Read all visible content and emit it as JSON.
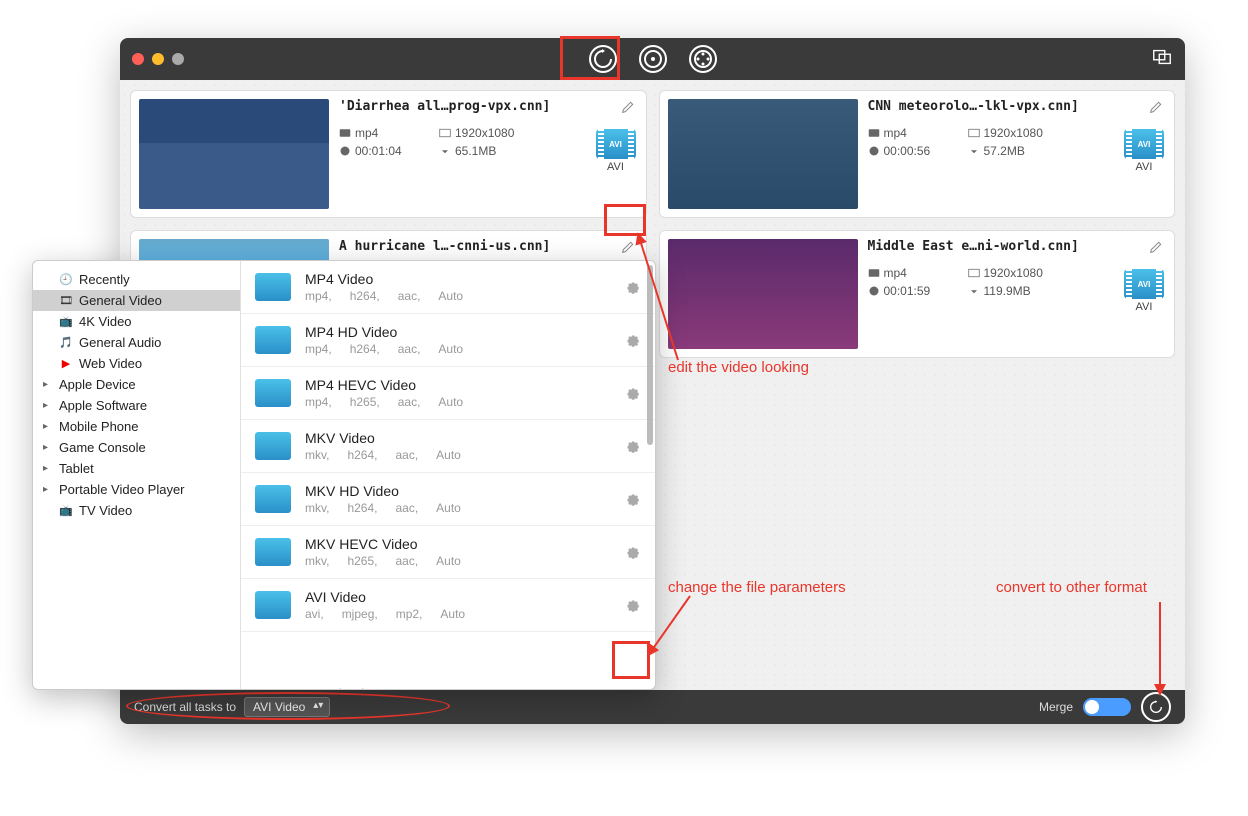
{
  "titlebar": {
    "icons": [
      "convert-icon",
      "rip-icon",
      "movie-icon",
      "tasks-icon"
    ]
  },
  "cards": [
    {
      "title": "'Diarrhea all…prog-vpx.cnn]",
      "format": "mp4",
      "res": "1920x1080",
      "dur": "00:01:04",
      "size": "65.1MB",
      "badge": "AVI"
    },
    {
      "title": "CNN meteorolo…-lkl-vpx.cnn]",
      "format": "mp4",
      "res": "1920x1080",
      "dur": "00:00:56",
      "size": "57.2MB",
      "badge": "AVI"
    },
    {
      "title": "A hurricane l…-cnni-us.cnn]",
      "format": "",
      "res": "",
      "dur": "",
      "size": "",
      "badge": ""
    },
    {
      "title": "Middle East e…ni-world.cnn]",
      "format": "mp4",
      "res": "1920x1080",
      "dur": "00:01:59",
      "size": "119.9MB",
      "badge": "AVI"
    }
  ],
  "categories": [
    {
      "label": "Recently",
      "icon": "clock"
    },
    {
      "label": "General Video",
      "icon": "film",
      "selected": true
    },
    {
      "label": "4K Video",
      "icon": "4k"
    },
    {
      "label": "General Audio",
      "icon": "audio"
    },
    {
      "label": "Web Video",
      "icon": "yt"
    },
    {
      "label": "Apple Device",
      "expand": true
    },
    {
      "label": "Apple Software",
      "expand": true
    },
    {
      "label": "Mobile Phone",
      "expand": true
    },
    {
      "label": "Game Console",
      "expand": true
    },
    {
      "label": "Tablet",
      "expand": true
    },
    {
      "label": "Portable Video Player",
      "expand": true
    },
    {
      "label": "TV Video",
      "icon": "tv"
    }
  ],
  "formats": [
    {
      "name": "MP4 Video",
      "d": [
        "mp4,",
        "h264,",
        "aac,",
        "Auto"
      ]
    },
    {
      "name": "MP4 HD Video",
      "d": [
        "mp4,",
        "h264,",
        "aac,",
        "Auto"
      ]
    },
    {
      "name": "MP4 HEVC Video",
      "d": [
        "mp4,",
        "h265,",
        "aac,",
        "Auto"
      ]
    },
    {
      "name": "MKV Video",
      "d": [
        "mkv,",
        "h264,",
        "aac,",
        "Auto"
      ]
    },
    {
      "name": "MKV HD Video",
      "d": [
        "mkv,",
        "h264,",
        "aac,",
        "Auto"
      ]
    },
    {
      "name": "MKV HEVC Video",
      "d": [
        "mkv,",
        "h265,",
        "aac,",
        "Auto"
      ]
    },
    {
      "name": "AVI Video",
      "d": [
        "avi,",
        "mjpeg,",
        "mp2,",
        "Auto"
      ]
    }
  ],
  "footer": {
    "label": "Convert all tasks to",
    "selected": "AVI Video",
    "merge": "Merge"
  },
  "annotations": {
    "edit": "edit the video looking",
    "params": "change the file parameters",
    "convert": "convert to other format"
  }
}
